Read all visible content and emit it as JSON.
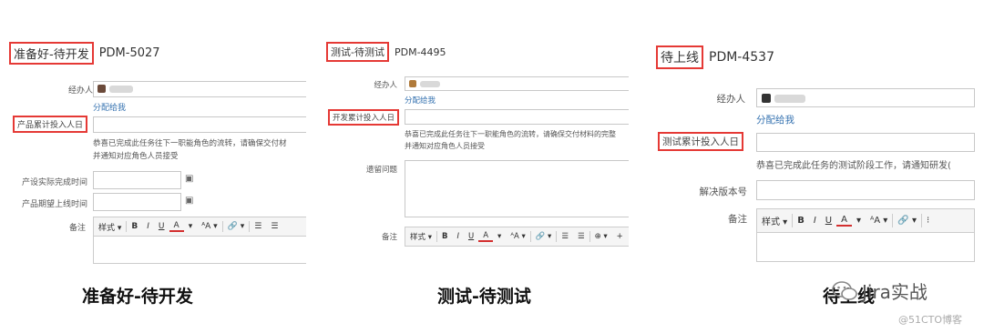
{
  "panel1": {
    "status": "准备好-待开发",
    "issue_key": "PDM-5027",
    "assignee_label": "经办人",
    "assign_to_me": "分配给我",
    "effort_label": "产品累计投入人日",
    "message_line1": "恭喜已完成此任务往下一职能角色的流转，请确保交付材",
    "message_line2": "并通知对应角色人员接受",
    "actual_done_label": "产设实际完成时间",
    "expected_release_label": "产品期望上线时间",
    "comment_label": "备注",
    "toolbar": [
      "样式 ▾",
      "B",
      "I",
      "U",
      "A",
      "▾",
      "ᴬA ▾",
      "🔗 ▾",
      "☰",
      "☰"
    ]
  },
  "panel2": {
    "status": "测试-待测试",
    "issue_key": "PDM-4495",
    "assignee_label": "经办人",
    "assign_to_me": "分配给我",
    "effort_label": "开发累计投入人日",
    "message_line1": "恭喜已完成此任务往下一职能角色的流转，请确保交付材料的完整",
    "message_line2": "并通知对应角色人员接受",
    "remaining_issues_label": "遗留问题",
    "comment_label": "备注",
    "toolbar": [
      "样式 ▾",
      "B",
      "I",
      "U",
      "A",
      "▾",
      "ᴬA ▾",
      "🔗 ▾",
      "☰",
      "☰",
      "⊕ ▾",
      "+"
    ]
  },
  "panel3": {
    "status": "待上线",
    "issue_key": "PDM-4537",
    "assignee_label": "经办人",
    "assign_to_me": "分配给我",
    "effort_label": "测试累计投入人日",
    "message_line1": "恭喜已完成此任务的测试阶段工作，请通知研发(",
    "fix_version_label": "解决版本号",
    "comment_label": "备注",
    "toolbar": [
      "样式 ▾",
      "B",
      "I",
      "U",
      "A",
      "▾",
      "ᴬA ▾",
      "🔗 ▾",
      "⁝"
    ]
  },
  "captions": {
    "c1": "准备好-待开发",
    "c2": "测试-待测试",
    "c3": "待上线"
  },
  "watermark": {
    "brand": "Jira实战",
    "site": "@51CTO博客"
  }
}
